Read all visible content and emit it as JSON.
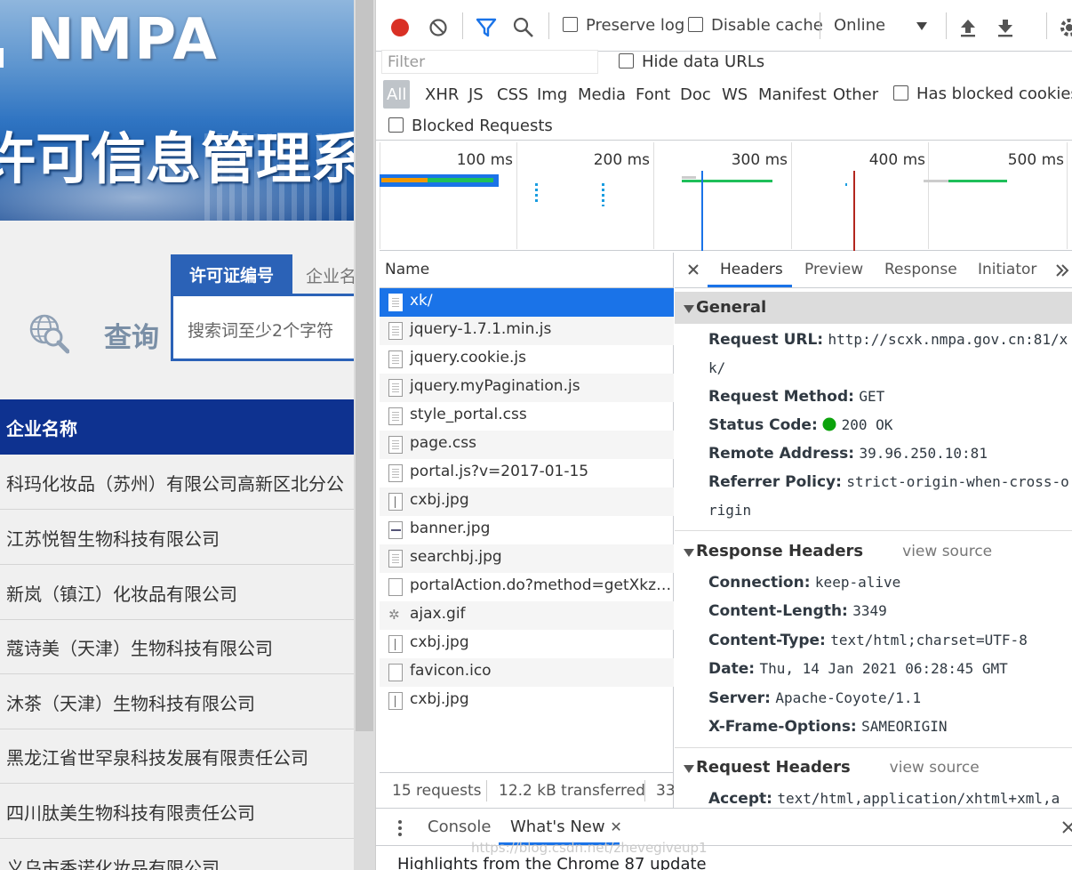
{
  "page": {
    "brand": "NMPA",
    "banner_title": "许可信息管理系",
    "tab_license": "许可证编号",
    "tab_company": "企业名",
    "search_placeholder": "搜索词至少2个字符",
    "query_label": "查询",
    "company_header": "企业名称",
    "companies": [
      "科玛化妆品（苏州）有限公司高新区北分公",
      "江苏悦智生物科技有限公司",
      "新岚（镇江）化妆品有限公司",
      "蔻诗美（天津）生物科技有限公司",
      "沐茶（天津）生物科技有限公司",
      "黑龙江省世罕泉科技发展有限责任公司",
      "四川肽美生物科技有限责任公司",
      "义乌市香诺化妆品有限公司"
    ]
  },
  "toolbar": {
    "preserve_log": "Preserve log",
    "disable_cache": "Disable cache",
    "throttle": "Online"
  },
  "filter": {
    "placeholder": "Filter",
    "hide_data_urls": "Hide data URLs",
    "types": [
      "All",
      "XHR",
      "JS",
      "CSS",
      "Img",
      "Media",
      "Font",
      "Doc",
      "WS",
      "Manifest",
      "Other"
    ],
    "has_blocked_cookies": "Has blocked cookies",
    "blocked_requests": "Blocked Requests"
  },
  "overview": {
    "labels": [
      "100 ms",
      "200 ms",
      "300 ms",
      "400 ms",
      "500 ms"
    ]
  },
  "requests": {
    "column_name": "Name",
    "items": [
      {
        "name": "xk/",
        "icon": "doc"
      },
      {
        "name": "jquery-1.7.1.min.js",
        "icon": "doc"
      },
      {
        "name": "jquery.cookie.js",
        "icon": "doc"
      },
      {
        "name": "jquery.myPagination.js",
        "icon": "doc"
      },
      {
        "name": "style_portal.css",
        "icon": "doc"
      },
      {
        "name": "page.css",
        "icon": "doc"
      },
      {
        "name": "portal.js?v=2017-01-15",
        "icon": "doc"
      },
      {
        "name": "cxbj.jpg",
        "icon": "img"
      },
      {
        "name": "banner.jpg",
        "icon": "banner"
      },
      {
        "name": "searchbj.jpg",
        "icon": "doc"
      },
      {
        "name": "portalAction.do?method=getXkzsList",
        "icon": "blank"
      },
      {
        "name": "ajax.gif",
        "icon": "spinner"
      },
      {
        "name": "cxbj.jpg",
        "icon": "img"
      },
      {
        "name": "favicon.ico",
        "icon": "blank"
      },
      {
        "name": "cxbj.jpg",
        "icon": "img"
      }
    ],
    "status_requests": "15 requests",
    "status_transferred": "12.2 kB transferred",
    "status_more": "33"
  },
  "detail_tabs": [
    "Headers",
    "Preview",
    "Response",
    "Initiator"
  ],
  "general": {
    "title": "General",
    "request_url_key": "Request URL:",
    "request_url": "http://scxk.nmpa.gov.cn:81/xk/",
    "method_key": "Request Method:",
    "method": "GET",
    "status_key": "Status Code:",
    "status": "200 OK",
    "remote_key": "Remote Address:",
    "remote": "39.96.250.10:81",
    "referrer_key": "Referrer Policy:",
    "referrer": "strict-origin-when-cross-origin"
  },
  "response_headers": {
    "title": "Response Headers",
    "view_source": "view source",
    "items": [
      {
        "k": "Connection:",
        "v": "keep-alive"
      },
      {
        "k": "Content-Length:",
        "v": "3349"
      },
      {
        "k": "Content-Type:",
        "v": "text/html;charset=UTF-8"
      },
      {
        "k": "Date:",
        "v": "Thu, 14 Jan 2021 06:28:45 GMT"
      },
      {
        "k": "Server:",
        "v": "Apache-Coyote/1.1"
      },
      {
        "k": "X-Frame-Options:",
        "v": "SAMEORIGIN"
      }
    ]
  },
  "request_headers": {
    "title": "Request Headers",
    "view_source": "view source",
    "accept_key": "Accept:",
    "accept": "text/html,application/xhtml+xml,a"
  },
  "drawer": {
    "console": "Console",
    "whats_new": "What's New",
    "highlight": "Highlights from the Chrome 87 update"
  },
  "watermark": "https://blog.csdn.net/zhevegiveup1",
  "colors": {
    "record": "#d93025",
    "accent": "#1a73e8",
    "nav_dark": "#0e3290",
    "nav_blue": "#2b62b7",
    "status_ok": "#0ca30c"
  }
}
